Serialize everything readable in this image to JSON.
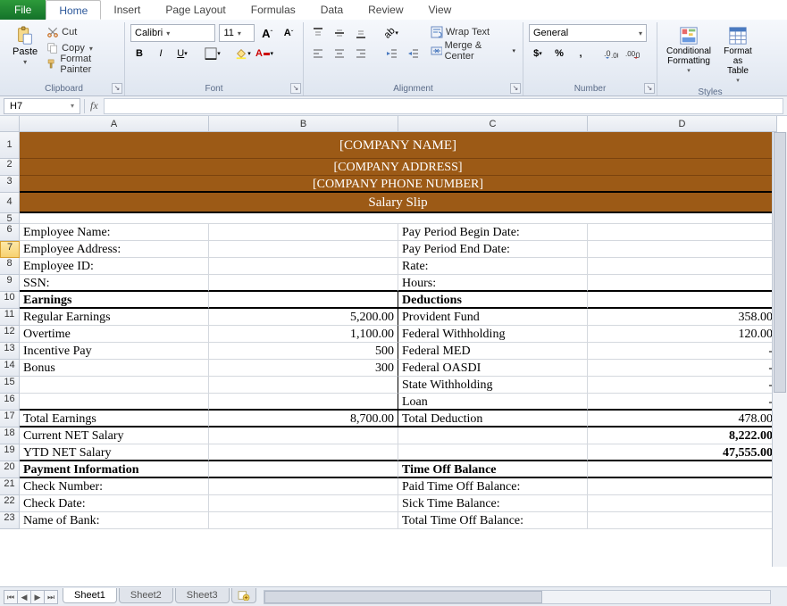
{
  "tabs": {
    "file": "File",
    "home": "Home",
    "insert": "Insert",
    "pagelayout": "Page Layout",
    "formulas": "Formulas",
    "data": "Data",
    "review": "Review",
    "view": "View"
  },
  "clipboard": {
    "paste": "Paste",
    "cut": "Cut",
    "copy": "Copy",
    "fmtpainter": "Format Painter",
    "label": "Clipboard"
  },
  "font": {
    "name": "Calibri",
    "size": "11",
    "label": "Font"
  },
  "alignment": {
    "wrap": "Wrap Text",
    "merge": "Merge & Center",
    "label": "Alignment"
  },
  "number": {
    "format": "General",
    "label": "Number"
  },
  "styles": {
    "cond": "Conditional Formatting",
    "table": "Format as Table",
    "label": "Styles"
  },
  "namebox": "H7",
  "cols": [
    "A",
    "B",
    "C",
    "D"
  ],
  "rows": {
    "r1": {
      "a": "[COMPANY NAME]"
    },
    "r2": {
      "a": "[COMPANY ADDRESS]"
    },
    "r3": {
      "a": "[COMPANY PHONE NUMBER]"
    },
    "r4": {
      "a": "Salary Slip"
    },
    "r6": {
      "a": "Employee Name:",
      "c": "Pay Period Begin Date:"
    },
    "r7": {
      "a": "Employee Address:",
      "c": "Pay Period End Date:"
    },
    "r8": {
      "a": "Employee ID:",
      "c": "Rate:"
    },
    "r9": {
      "a": "SSN:",
      "c": "Hours:"
    },
    "r10": {
      "a": "Earnings",
      "c": "Deductions"
    },
    "r11": {
      "a": "Regular Earnings",
      "b": "5,200.00",
      "c": "Provident Fund",
      "d": "358.00"
    },
    "r12": {
      "a": "Overtime",
      "b": "1,100.00",
      "c": "Federal Withholding",
      "d": "120.00"
    },
    "r13": {
      "a": "Incentive Pay",
      "b": "500",
      "c": "Federal MED",
      "d": "-"
    },
    "r14": {
      "a": "Bonus",
      "b": "300",
      "c": "Federal OASDI",
      "d": "-"
    },
    "r15": {
      "c": "State Withholding",
      "d": "-"
    },
    "r16": {
      "c": "Loan",
      "d": "-"
    },
    "r17": {
      "a": "Total Earnings",
      "b": "8,700.00",
      "c": "Total Deduction",
      "d": "478.00"
    },
    "r18": {
      "a": "Current NET Salary",
      "d": "8,222.00"
    },
    "r19": {
      "a": "YTD NET Salary",
      "d": "47,555.00"
    },
    "r20": {
      "a": "Payment Information",
      "c": "Time Off Balance"
    },
    "r21": {
      "a": "Check  Number:",
      "c": "Paid Time Off Balance:"
    },
    "r22": {
      "a": "Check Date:",
      "c": "Sick Time Balance:"
    },
    "r23": {
      "a": "Name of Bank:",
      "c": "Total Time Off Balance:"
    }
  },
  "sheets": {
    "s1": "Sheet1",
    "s2": "Sheet2",
    "s3": "Sheet3"
  }
}
